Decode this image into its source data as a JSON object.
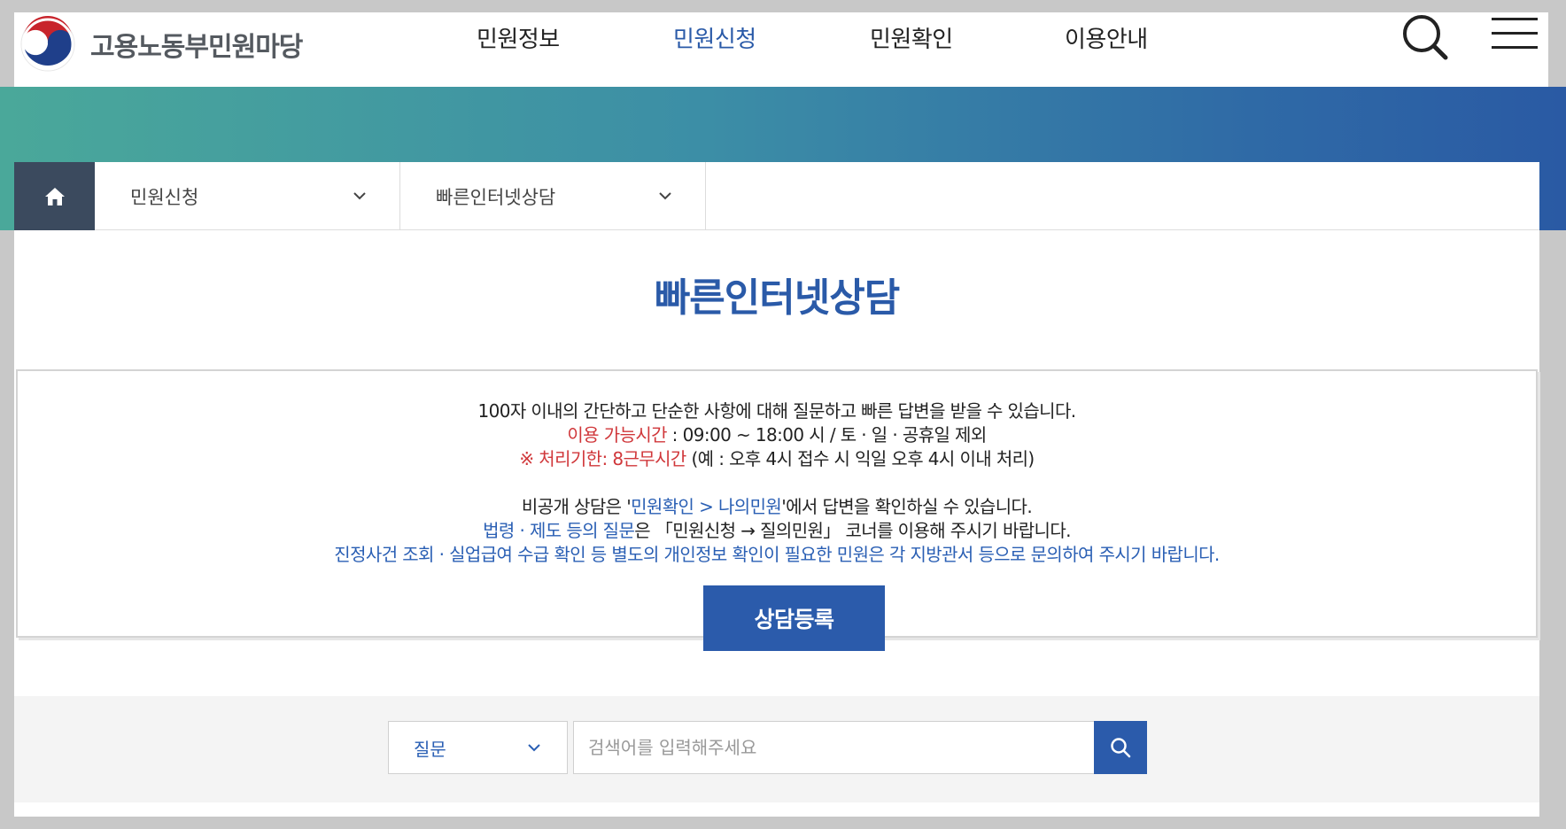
{
  "header": {
    "logo_text": "고용노동부민원마당",
    "nav": [
      {
        "label": "민원정보",
        "active": false
      },
      {
        "label": "민원신청",
        "active": true
      },
      {
        "label": "민원확인",
        "active": false
      },
      {
        "label": "이용안내",
        "active": false
      }
    ],
    "icons": {
      "search": "search-icon",
      "menu": "hamburger-menu-icon"
    }
  },
  "breadcrumb": {
    "home_icon": "home-icon",
    "level1": "민원신청",
    "level2": "빠른인터넷상담"
  },
  "page_title": "빠른인터넷상담",
  "notice": {
    "line1": "100자 이내의 간단하고 단순한 사항에 대해 질문하고 빠른 답변을 받을 수 있습니다.",
    "line2_red": "이용 가능시간",
    "line2_rest": " : 09:00 ~ 18:00 시 / 토 · 일 · 공휴일 제외",
    "line3_red": "※ 처리기한: 8근무시간",
    "line3_rest": " (예 : 오후 4시 접수 시 익일 오후 4시 이내 처리)",
    "line4_pre": "비공개 상담은 '",
    "line4_link": "민원확인 > 나의민원",
    "line4_post": "'에서 답변을 확인하실 수 있습니다.",
    "line5_blue": "법령 · 제도 등의 질문",
    "line5_rest": "은 「민원신청 → 질의민원」 코너를 이용해 주시기 바랍니다.",
    "line6": "진정사건 조회 · 실업급여 수급 확인 등 별도의 개인정보 확인이 필요한 민원은 각 지방관서 등으로 문의하여 주시기 바랍니다."
  },
  "register_button": "상담등록",
  "search": {
    "select_value": "질문",
    "placeholder": "검색어를 입력해주세요",
    "submit_icon": "search-icon"
  },
  "colors": {
    "primary": "#2b5bab",
    "accent_red": "#d0373a",
    "link_blue": "#2a5fb4",
    "breadcrumb_home_bg": "#3b4a5e"
  }
}
